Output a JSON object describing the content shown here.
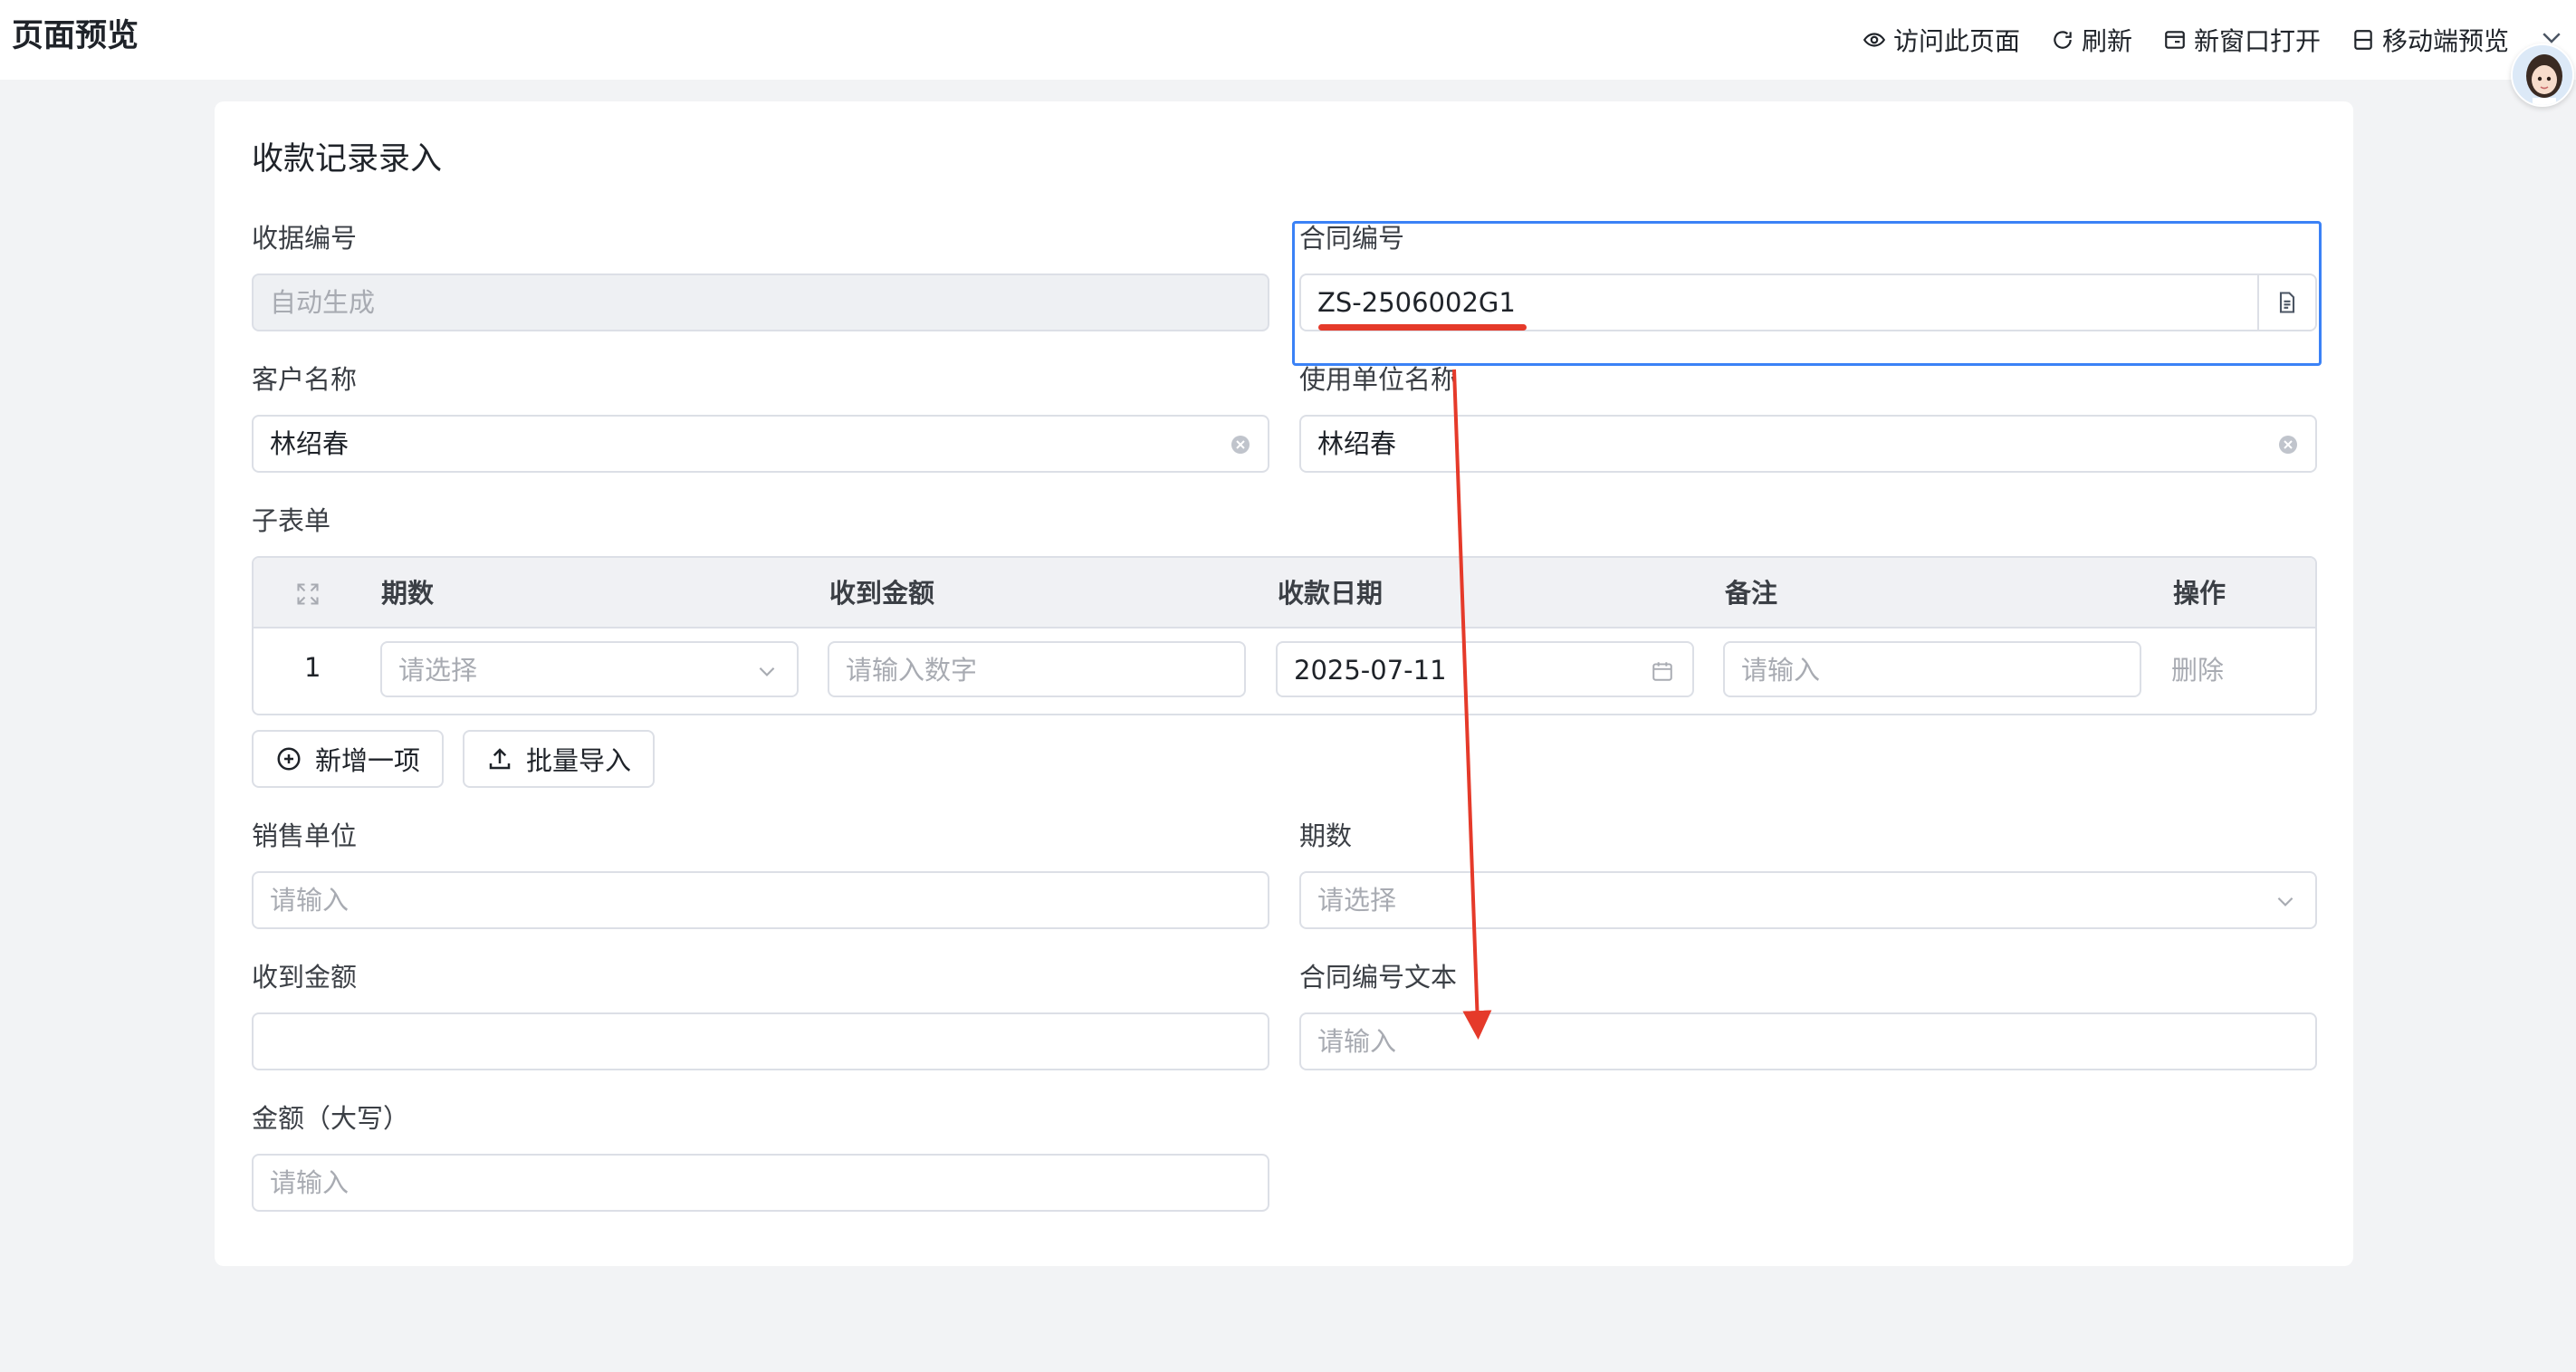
{
  "header": {
    "title": "页面预览",
    "actions": [
      {
        "label": "访问此页面",
        "icon": "eye-icon"
      },
      {
        "label": "刷新",
        "icon": "refresh-icon"
      },
      {
        "label": "新窗口打开",
        "icon": "new-window-icon"
      },
      {
        "label": "移动端预览",
        "icon": "mobile-icon"
      }
    ]
  },
  "form": {
    "title": "收款记录录入",
    "receipt_no": {
      "label": "收据编号",
      "value": "自动生成"
    },
    "contract_no": {
      "label": "合同编号",
      "value": "ZS-2506002G1"
    },
    "customer_name": {
      "label": "客户名称",
      "value": "林绍春"
    },
    "user_unit_name": {
      "label": "使用单位名称",
      "value": "林绍春"
    },
    "subform": {
      "label": "子表单",
      "columns": [
        "期数",
        "收到金额",
        "收款日期",
        "备注",
        "操作"
      ],
      "rows": [
        {
          "index": "1",
          "period_placeholder": "请选择",
          "amount_placeholder": "请输入数字",
          "date": "2025-07-11",
          "remark_placeholder": "请输入",
          "action": "删除"
        }
      ],
      "add_button": "新增一项",
      "import_button": "批量导入"
    },
    "sales_unit": {
      "label": "销售单位",
      "placeholder": "请输入"
    },
    "period": {
      "label": "期数",
      "placeholder": "请选择"
    },
    "received_amount": {
      "label": "收到金额",
      "value": ""
    },
    "contract_no_text": {
      "label": "合同编号文本",
      "placeholder": "请输入"
    },
    "amount_capital": {
      "label": "金额（大写）",
      "placeholder": "请输入"
    }
  },
  "colors": {
    "highlight_border": "#3b82f6",
    "annotation_red": "#e53a2a"
  }
}
